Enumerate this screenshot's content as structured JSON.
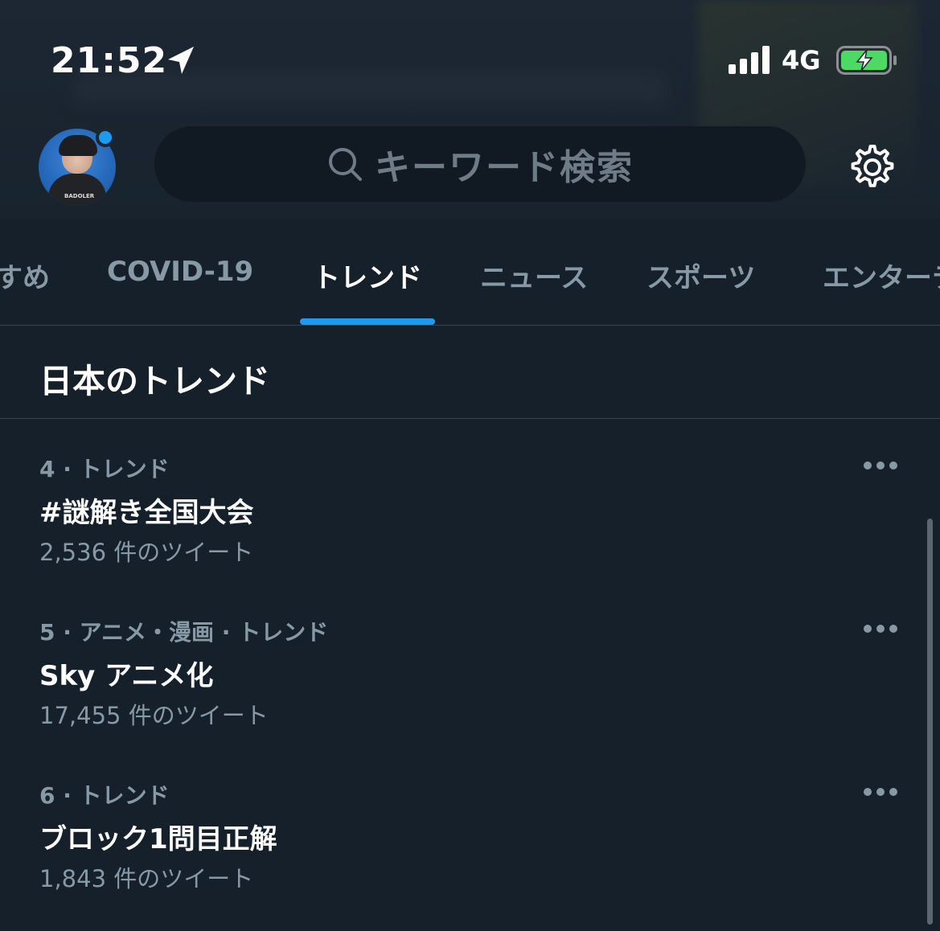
{
  "status_bar": {
    "time": "21:52",
    "network": "4G",
    "battery_color": "#4cd964"
  },
  "search": {
    "placeholder": "キーワード検索"
  },
  "avatar": {
    "shirt_text": "BADOLER"
  },
  "tabs": [
    {
      "label": "すめ",
      "active": false
    },
    {
      "label": "COVID-19",
      "active": false
    },
    {
      "label": "トレンド",
      "active": true
    },
    {
      "label": "ニュース",
      "active": false
    },
    {
      "label": "スポーツ",
      "active": false
    },
    {
      "label": "エンターテ",
      "active": false
    }
  ],
  "section": {
    "title": "日本のトレンド"
  },
  "trends": [
    {
      "meta": "4 · トレンド",
      "name": "#謎解き全国大会",
      "count": "2,536 件のツイート"
    },
    {
      "meta": "5 · アニメ・漫画 · トレンド",
      "name": "Sky アニメ化",
      "count": "17,455 件のツイート"
    },
    {
      "meta": "6 · トレンド",
      "name": "ブロック1問目正解",
      "count": "1,843 件のツイート"
    }
  ],
  "colors": {
    "accent": "#1d9bf0",
    "background": "#15202b",
    "secondary_text": "#8899a6"
  }
}
